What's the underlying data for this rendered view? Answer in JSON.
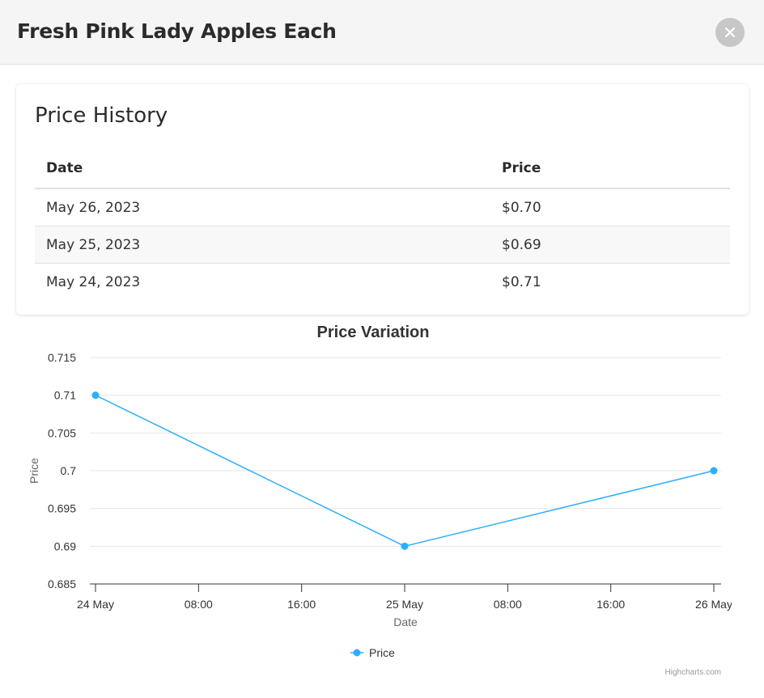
{
  "modal": {
    "title": "Fresh Pink Lady Apples Each",
    "close_icon": "close-icon"
  },
  "history": {
    "title": "Price History",
    "columns": [
      "Date",
      "Price"
    ],
    "rows": [
      {
        "date": "May 26, 2023",
        "price": "$0.70"
      },
      {
        "date": "May 25, 2023",
        "price": "$0.69"
      },
      {
        "date": "May 24, 2023",
        "price": "$0.71"
      }
    ]
  },
  "chart_data": {
    "type": "line",
    "title": "Price Variation",
    "xlabel": "Date",
    "ylabel": "Price",
    "x_tick_labels": [
      "24 May",
      "08:00",
      "16:00",
      "25 May",
      "08:00",
      "16:00",
      "26 May"
    ],
    "y_tick_labels": [
      "0.715",
      "0.71",
      "0.705",
      "0.7",
      "0.695",
      "0.69",
      "0.685"
    ],
    "ylim": [
      0.685,
      0.715
    ],
    "y_ticks": [
      0.715,
      0.71,
      0.705,
      0.7,
      0.695,
      0.69,
      0.685
    ],
    "series": [
      {
        "name": "Price",
        "x": [
          "2023-05-24",
          "2023-05-25",
          "2023-05-26"
        ],
        "values": [
          0.71,
          0.69,
          0.7
        ]
      }
    ],
    "legend": "bottom-center",
    "grid": true,
    "color": "#2caffe",
    "credits": "Highcharts.com"
  }
}
